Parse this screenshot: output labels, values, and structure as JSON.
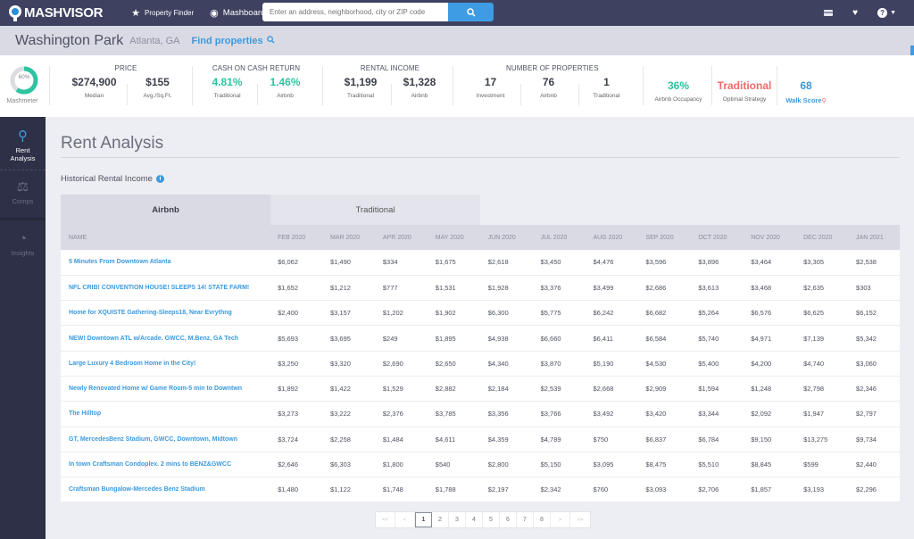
{
  "topnav": {
    "brand": "MASHVISOR",
    "property_finder": "Property Finder",
    "mashboard": "Mashboard",
    "search_placeholder": "Enter an address, neighborhood, city or ZIP code",
    "icons": [
      "search-icon",
      "card-icon",
      "heart-icon",
      "help-icon"
    ]
  },
  "location": {
    "neighborhood": "Washington Park",
    "city": "Atlanta, GA",
    "find_properties": "Find properties"
  },
  "stats": {
    "mashmeter": {
      "value": "60%",
      "fraction": 0.6,
      "label": "Mashmeter"
    },
    "price": {
      "title": "PRICE",
      "items": [
        {
          "value": "$274,900",
          "label": "Median"
        },
        {
          "value": "$155",
          "label": "Avg./Sq.Ft."
        }
      ]
    },
    "cash_on_cash": {
      "title": "CASH ON CASH RETURN",
      "items": [
        {
          "value": "4.81%",
          "label": "Traditional"
        },
        {
          "value": "1.46%",
          "label": "Airbnb"
        }
      ]
    },
    "rental_income": {
      "title": "RENTAL INCOME",
      "items": [
        {
          "value": "$1,199",
          "label": "Traditional"
        },
        {
          "value": "$1,328",
          "label": "Airbnb"
        }
      ]
    },
    "num_properties": {
      "title": "NUMBER OF PROPERTIES",
      "items": [
        {
          "value": "17",
          "label": "Investment"
        },
        {
          "value": "76",
          "label": "Airbnb"
        },
        {
          "value": "1",
          "label": "Traditional"
        }
      ]
    },
    "occupancy": {
      "value": "36%",
      "label": "Airbnb Occupancy"
    },
    "strategy": {
      "value": "Traditional",
      "label": "Optimal Strategy"
    },
    "walk_score": {
      "value": "68",
      "label": "Walk Score"
    },
    "colors": {
      "green": "#2ec4a0",
      "red": "#f26a6a",
      "blue": "#3a9ae0"
    }
  },
  "sidebar": {
    "items": [
      {
        "label_line1": "Rent",
        "label_line2": "Analysis",
        "icon": "key-icon",
        "active": true
      },
      {
        "label": "Comps",
        "icon": "scale-icon",
        "active": false
      },
      {
        "label": "Insights",
        "icon": "pie-chart-icon",
        "active": false
      }
    ]
  },
  "main": {
    "title": "Rent Analysis",
    "section_label": "Historical Rental Income",
    "tabs": [
      {
        "label": "Airbnb",
        "active": true
      },
      {
        "label": "Traditional",
        "active": false
      }
    ],
    "columns": [
      "NAME",
      "FEB 2020",
      "MAR 2020",
      "APR 2020",
      "MAY 2020",
      "JUN 2020",
      "JUL 2020",
      "AUG 2020",
      "SEP 2020",
      "OCT 2020",
      "NOV 2020",
      "DEC 2020",
      "JAN 2021"
    ],
    "rows": [
      {
        "name": "5 Minutes From Downtown Atlanta",
        "values": [
          "$6,062",
          "$1,490",
          "$334",
          "$1,675",
          "$2,618",
          "$3,450",
          "$4,476",
          "$3,596",
          "$3,896",
          "$3,464",
          "$3,305",
          "$2,538"
        ]
      },
      {
        "name": "NFL CRIB! CONVENTION HOUSE! SLEEPS 14! STATE FARM!",
        "values": [
          "$1,652",
          "$1,212",
          "$777",
          "$1,531",
          "$1,928",
          "$3,376",
          "$3,499",
          "$2,686",
          "$3,613",
          "$3,468",
          "$2,635",
          "$303"
        ]
      },
      {
        "name": "Home for XQUISTE Gathering-Sleeps18, Near Evrythng",
        "values": [
          "$2,400",
          "$3,157",
          "$1,202",
          "$1,902",
          "$6,300",
          "$5,775",
          "$6,242",
          "$6,682",
          "$5,264",
          "$6,576",
          "$6,625",
          "$6,152"
        ]
      },
      {
        "name": "NEW! Downtown ATL w/Arcade. GWCC, M.Benz, GA Tech",
        "values": [
          "$5,693",
          "$3,695",
          "$249",
          "$1,895",
          "$4,938",
          "$6,660",
          "$6,411",
          "$6,584",
          "$5,740",
          "$4,971",
          "$7,139",
          "$5,342"
        ]
      },
      {
        "name": "Large Luxury 4 Bedroom Home in the City!",
        "values": [
          "$3,250",
          "$3,320",
          "$2,690",
          "$2,650",
          "$4,340",
          "$3,870",
          "$5,190",
          "$4,530",
          "$5,400",
          "$4,200",
          "$4,740",
          "$3,060"
        ]
      },
      {
        "name": "Newly Renovated Home w/ Game Room-5 min to Downtwn",
        "values": [
          "$1,892",
          "$1,422",
          "$1,529",
          "$2,882",
          "$2,184",
          "$2,539",
          "$2,668",
          "$2,909",
          "$1,594",
          "$1,248",
          "$2,798",
          "$2,346"
        ]
      },
      {
        "name": "The Hilltop",
        "values": [
          "$3,273",
          "$3,222",
          "$2,376",
          "$3,785",
          "$3,356",
          "$3,766",
          "$3,492",
          "$3,420",
          "$3,344",
          "$2,092",
          "$1,947",
          "$2,797"
        ]
      },
      {
        "name": "GT, MercedesBenz Stadium, GWCC, Downtown, Midtown",
        "values": [
          "$3,724",
          "$2,258",
          "$1,484",
          "$4,611",
          "$4,359",
          "$4,789",
          "$750",
          "$6,837",
          "$6,784",
          "$9,150",
          "$13,275",
          "$9,734"
        ]
      },
      {
        "name": "In town Craftsman Condoplex. 2 mins to BENZ&GWCC",
        "values": [
          "$2,646",
          "$6,303",
          "$1,800",
          "$540",
          "$2,800",
          "$5,150",
          "$3,095",
          "$8,475",
          "$5,510",
          "$8,845",
          "$599",
          "$2,440"
        ]
      },
      {
        "name": "Craftsman Bungalow-Mercedes Benz Stadium",
        "values": [
          "$1,480",
          "$1,122",
          "$1,748",
          "$1,788",
          "$2,197",
          "$2,342",
          "$760",
          "$3,093",
          "$2,706",
          "$1,857",
          "$3,193",
          "$2,296"
        ]
      }
    ],
    "pagination": {
      "first": "<<",
      "prev": "<",
      "pages": [
        "1",
        "2",
        "3",
        "4",
        "5",
        "6",
        "7",
        "8"
      ],
      "current": "1",
      "next": ">",
      "last": ">>"
    }
  }
}
